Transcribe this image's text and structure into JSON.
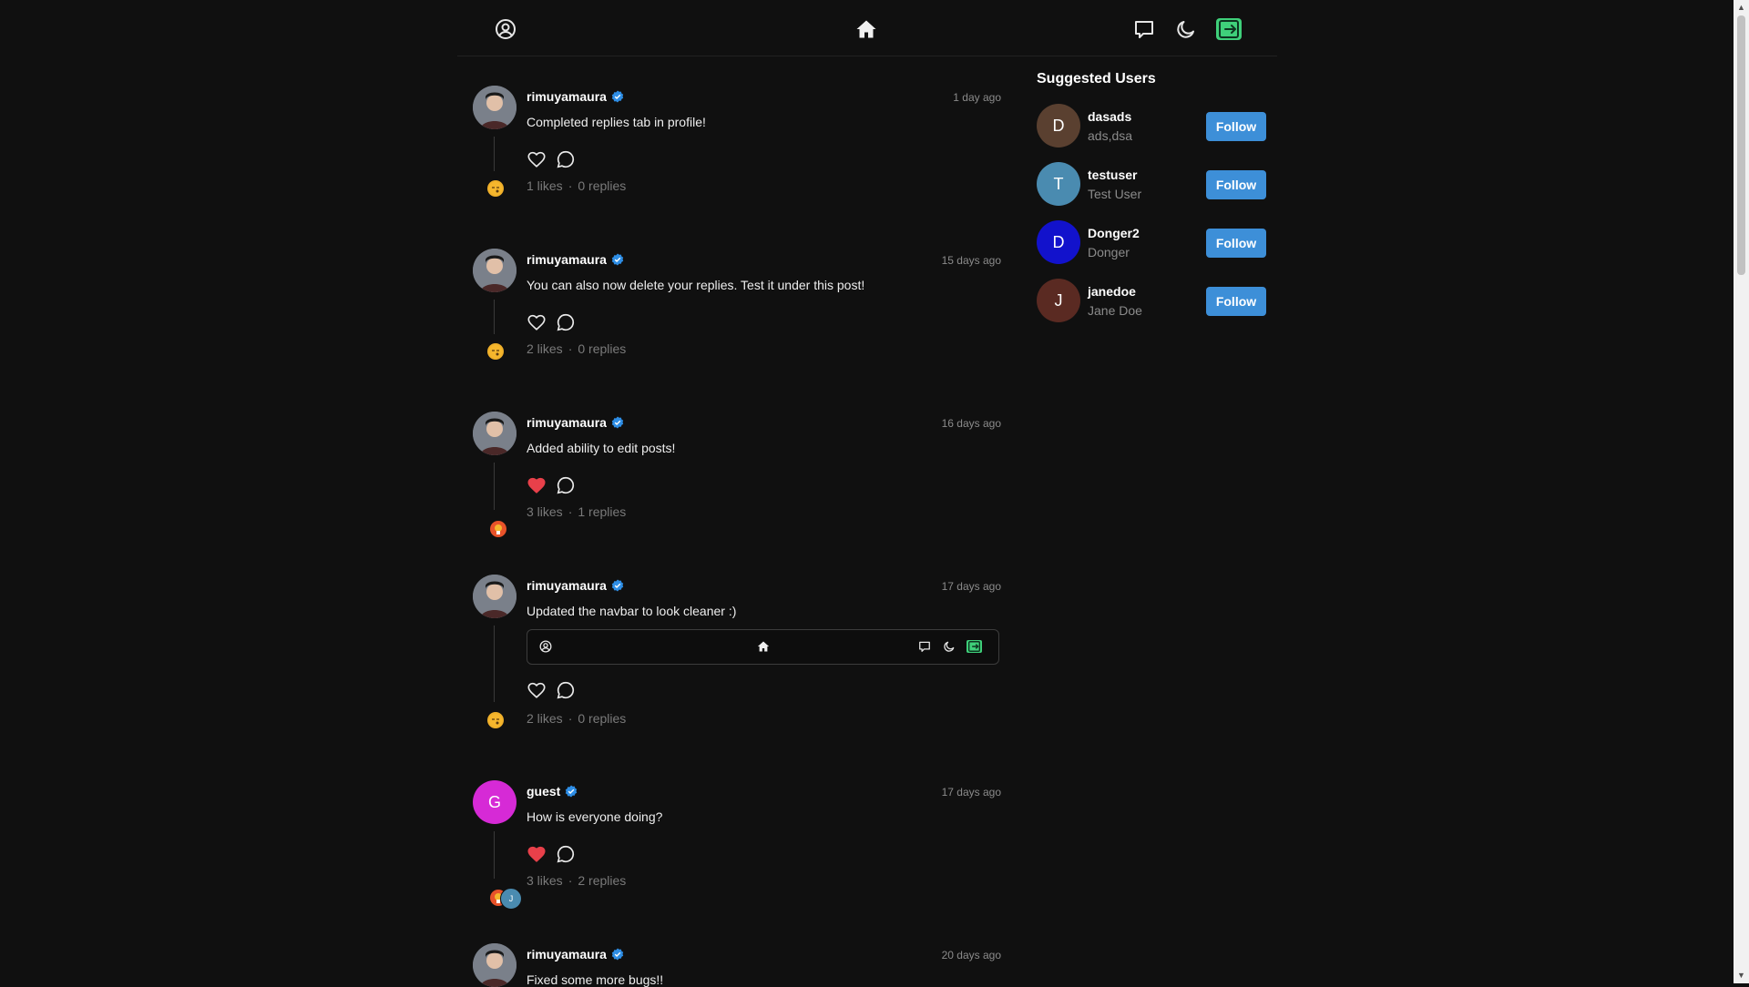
{
  "navbar": {
    "profile_icon": "user-circle-icon",
    "home_icon": "home-icon",
    "chat_icon": "chat-bubble-icon",
    "theme_icon": "moon-icon",
    "logout_icon": "logout-icon"
  },
  "posts": [
    {
      "username": "rimuyamaura",
      "verified": true,
      "time": "1 day ago",
      "text": "Completed replies tab in profile!",
      "liked": false,
      "likes": "1 likes",
      "replies": "0 replies"
    },
    {
      "username": "rimuyamaura",
      "verified": true,
      "time": "15 days ago",
      "text": "You can also now delete your replies. Test it under this post!",
      "liked": false,
      "likes": "2 likes",
      "replies": "0 replies"
    },
    {
      "username": "rimuyamaura",
      "verified": true,
      "time": "16 days ago",
      "text": "Added ability to edit posts!",
      "liked": true,
      "likes": "3 likes",
      "replies": "1 replies"
    },
    {
      "username": "rimuyamaura",
      "verified": true,
      "time": "17 days ago",
      "text": "Updated the navbar to look cleaner :)",
      "liked": false,
      "likes": "2 likes",
      "replies": "0 replies",
      "has_image": true
    },
    {
      "username": "guest",
      "verified": true,
      "time": "17 days ago",
      "text": "How is everyone doing?",
      "liked": true,
      "likes": "3 likes",
      "replies": "2 replies",
      "avatar_letter": "G"
    },
    {
      "username": "rimuyamaura",
      "verified": true,
      "time": "20 days ago",
      "text": "Fixed some more bugs!!"
    }
  ],
  "reply_avatar_letters": {
    "j": "J"
  },
  "suggested": {
    "title": "Suggested Users",
    "users": [
      {
        "letter": "D",
        "username": "dasads",
        "name": "ads,dsa",
        "button": "Follow",
        "color": "#5a4030"
      },
      {
        "letter": "T",
        "username": "testuser",
        "name": "Test User",
        "button": "Follow",
        "color": "#4a8bb0"
      },
      {
        "letter": "D",
        "username": "Donger2",
        "name": "Donger",
        "button": "Follow",
        "color": "#1212cc"
      },
      {
        "letter": "J",
        "username": "janedoe",
        "name": "Jane Doe",
        "button": "Follow",
        "color": "#5a2a22"
      }
    ]
  },
  "colors": {
    "accent": "#3d8fd8",
    "like_red": "#e8404a",
    "logout_green": "#3fd07a",
    "guest_avatar": "#d62ad6"
  }
}
